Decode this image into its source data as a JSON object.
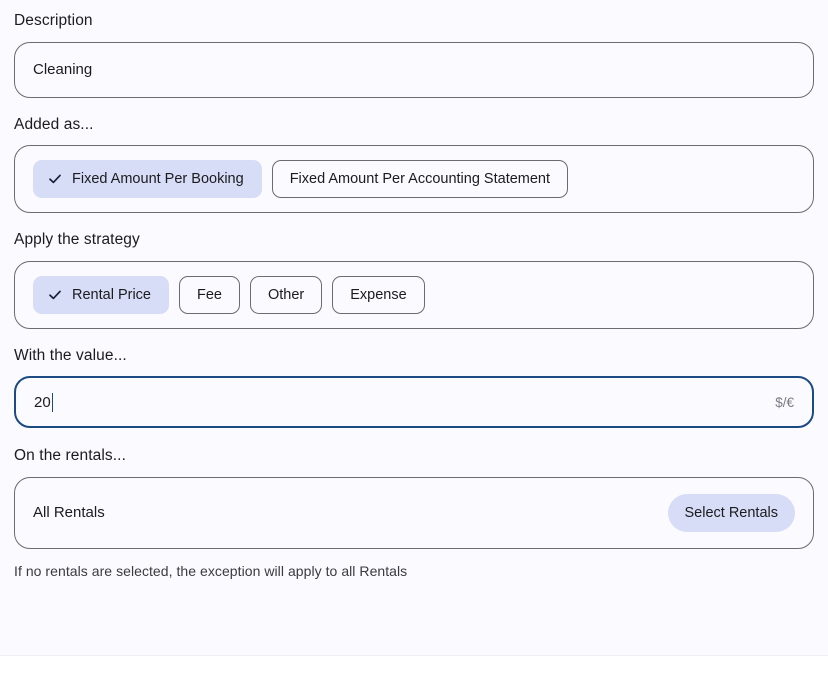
{
  "form": {
    "description": {
      "label": "Description",
      "value": "Cleaning"
    },
    "added_as": {
      "label": "Added as...",
      "options": [
        {
          "label": "Fixed Amount Per Booking",
          "selected": true
        },
        {
          "label": "Fixed Amount Per Accounting Statement",
          "selected": false
        }
      ]
    },
    "strategy": {
      "label": "Apply the strategy",
      "options": [
        {
          "label": "Rental Price",
          "selected": true
        },
        {
          "label": "Fee",
          "selected": false
        },
        {
          "label": "Other",
          "selected": false
        },
        {
          "label": "Expense",
          "selected": false
        }
      ]
    },
    "value": {
      "label": "With the value...",
      "value": "20",
      "suffix": "$/€"
    },
    "rentals": {
      "label": "On the rentals...",
      "summary": "All Rentals",
      "button_label": "Select Rentals",
      "helper_text": "If no rentals are selected, the exception will apply to all Rentals"
    }
  },
  "icons": {
    "check": "check-icon"
  },
  "colors": {
    "selected_chip_bg": "#d7dcf7",
    "focus_border": "#1c4a82",
    "border": "#6b6b72",
    "page_bg": "#fafaff",
    "text": "#1c1c1e"
  }
}
